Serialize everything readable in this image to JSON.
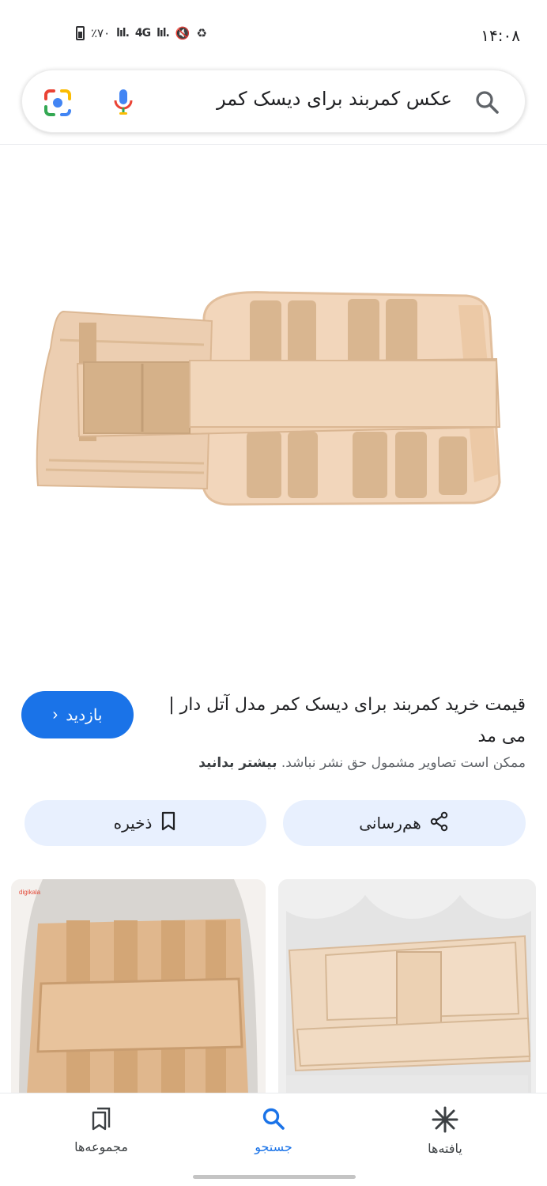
{
  "status_bar": {
    "time": "۱۴:۰۸",
    "battery": "٪۷۰",
    "network": "4G"
  },
  "search": {
    "query": "عکس کمربند برای دیسک کمر"
  },
  "result": {
    "title": "قیمت خرید کمربند برای دیسک کمر مدل آتل دار | می مد",
    "copyright_note": "ممکن است تصاویر مشمول حق نشر نباشد.",
    "learn_more": "بیشتر بدانید",
    "visit_label": "بازدید"
  },
  "actions": {
    "share_label": "هم‌رسانی",
    "save_label": "ذخیره"
  },
  "nav": {
    "collections": "مجموعه‌ها",
    "search": "جستجو",
    "discover": "یافته‌ها"
  },
  "thumbnails": {
    "left_watermark": "digikala"
  },
  "colors": {
    "accent": "#1a73e8",
    "action_bg": "#e8f0fe",
    "belt": "#efd2b4"
  }
}
